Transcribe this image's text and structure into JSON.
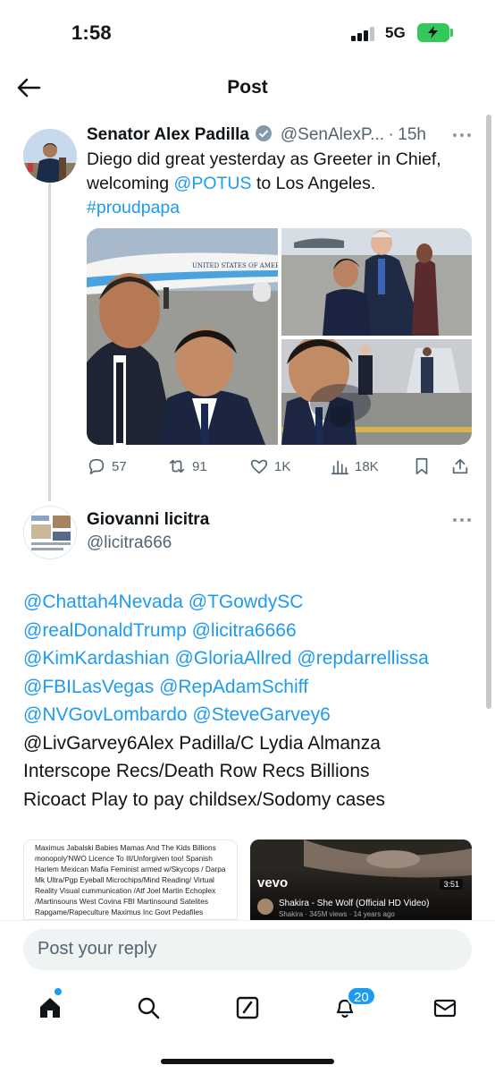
{
  "status_bar": {
    "time": "1:58",
    "network": "5G"
  },
  "header": {
    "title": "Post"
  },
  "tweet": {
    "author_name": "Senator Alex Padilla",
    "handle": "@SenAlexP...",
    "separator": "·",
    "time": "15h",
    "text_lines": [
      {
        "plain": "Diego did great yesterday as Greeter in Chief,"
      },
      {
        "plain": "welcoming ",
        "mention": "@POTUS",
        "rest": " to Los Angeles."
      },
      {
        "hashtag": "#proudpapa"
      }
    ],
    "image_text": "UNITED STATES OF AMERICA",
    "stats": {
      "replies": "57",
      "reposts": "91",
      "likes": "1K",
      "views": "18K"
    }
  },
  "reply": {
    "author_name": "Giovanni licitra",
    "handle": "@licitra666",
    "mention_lines": [
      "@Chattah4Nevada @TGowdySC",
      "@realDonaldTrump @licitra6666",
      "@KimKardashian @GloriaAllred @repdarrellissa",
      "@FBILasVegas @RepAdamSchiff",
      "@NVGovLombardo @SteveGarvey6"
    ],
    "text_lines": [
      "@LivGarvey6Alex Padilla/C Lydia Almanza",
      "Interscope Recs/Death Row Recs Billions",
      "Ricoact Play to pay childsex/Sodomy cases"
    ],
    "embed_document_text": "Maximus Jabalski Babies Mamas And The Kids Billions monopoly'NWO Licence To Ill/Unforgiven too! Spanish Harlem Mexican Mafia Feminist armed w/Skycops / Darpa Mk Ultra/Pgp Eyeball Microchips/Mind Reading/ Virtual Reality Visual cummunication /Atf Joel Martin Echoplex /Martinsouns West Covina FBI Martinsound Satelites Rapgame/Rapeculture Maximus Inc Govt Pedafiles /Rapist Monopoly ,Does the CIA Want to watch There Licence to Ill /Unforgiven too Hunger games",
    "video": {
      "brand": "vevo",
      "duration": "3:51",
      "title": "Shakira - She Wolf (Official HD Video)",
      "meta": "Shakira · 345M views · 14 years ago"
    }
  },
  "reply_bar": {
    "placeholder": "Post your reply"
  },
  "tabbar": {
    "notifications_badge": "20"
  },
  "colors": {
    "accent": "#1d9bf0",
    "text": "#0f1419",
    "muted": "#536471",
    "battery": "#34c759"
  }
}
